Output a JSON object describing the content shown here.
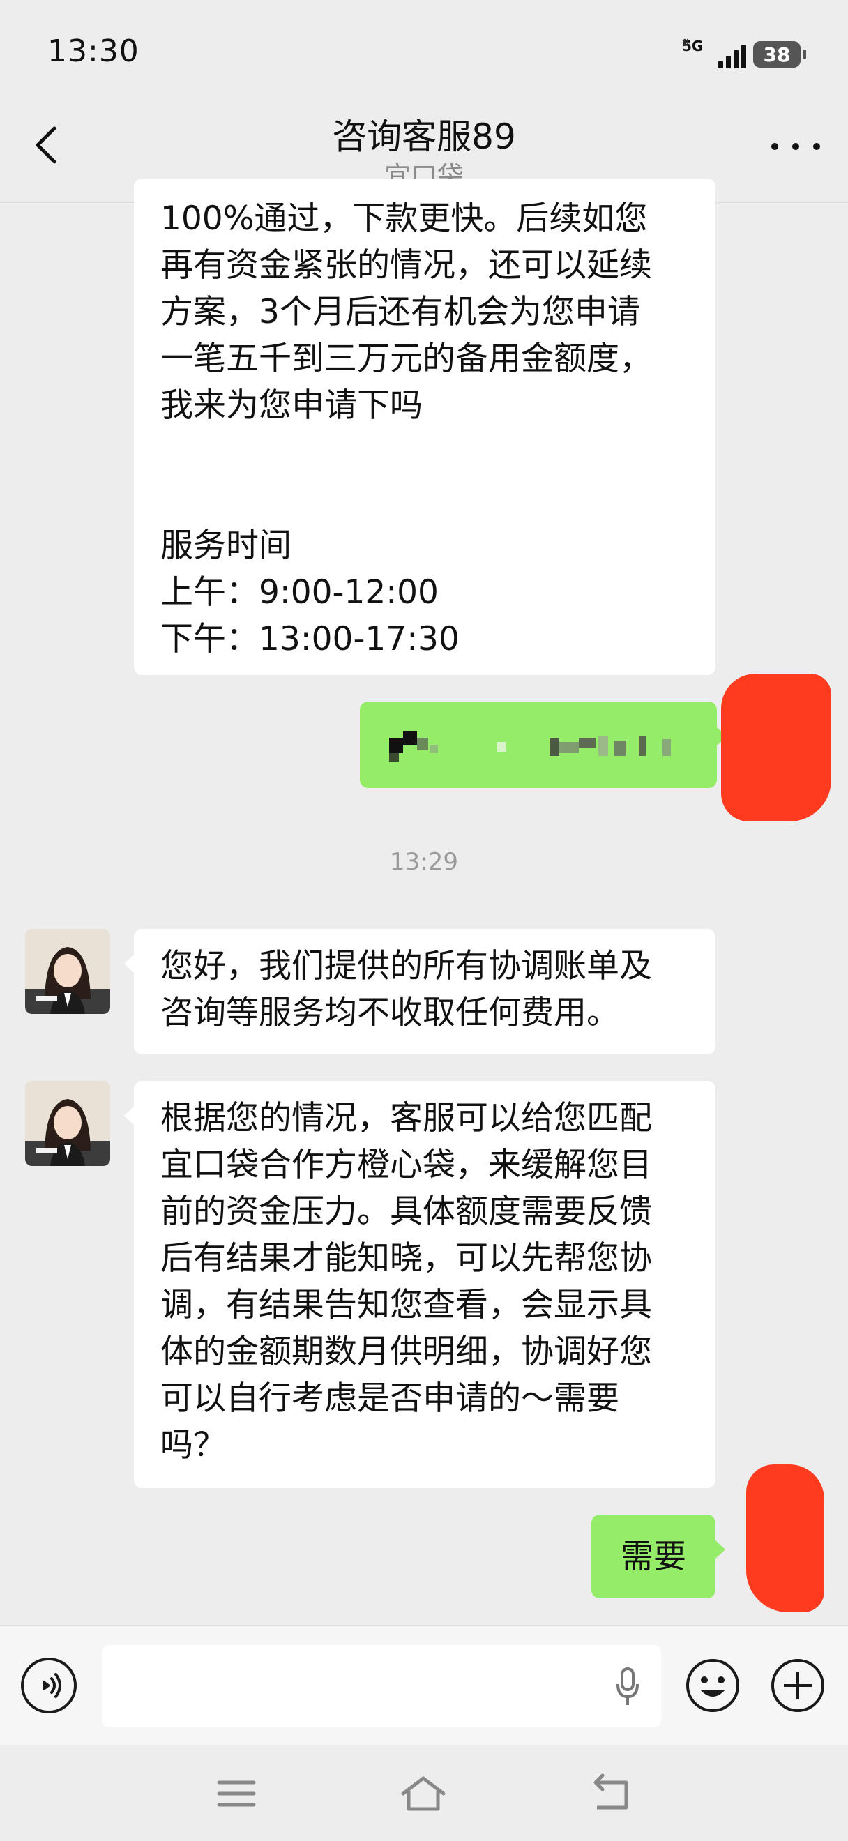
{
  "status_bar": {
    "time": "13:30",
    "network": "5G",
    "battery": "38"
  },
  "header": {
    "title": "咨询客服89",
    "subtitle": "宜口袋"
  },
  "messages": {
    "m1": {
      "lines": [
        "100%通过，下款更快。后续如您",
        "再有资金紧张的情况，还可以延续",
        "方案，3个月后还有机会为您申请",
        "一笔五千到三万元的备用金额度，",
        "我来为您申请下吗",
        "",
        "",
        "服务时间",
        "上午：9:00-12:00",
        "下午：13:00-17:30"
      ]
    },
    "timestamp": "13:29",
    "m3": {
      "lines": [
        "您好，我们提供的所有协调账单及",
        "咨询等服务均不收取任何费用。"
      ]
    },
    "m4": {
      "lines": [
        "根据您的情况，客服可以给您匹配",
        "宜口袋合作方橙心袋，来缓解您目",
        "前的资金压力。具体额度需要反馈",
        "后有结果才能知晓，可以先帮您协",
        "调，有结果告知您查看，会显示具",
        "体的金额期数月供明细，协调好您",
        "可以自行考虑是否申请的～需要",
        "吗？"
      ]
    },
    "m5": {
      "text": "需要"
    }
  },
  "colors": {
    "background": "#ededed",
    "outgoing_bubble": "#95ec69",
    "incoming_bubble": "#ffffff",
    "redaction": "#ff3b1f"
  }
}
